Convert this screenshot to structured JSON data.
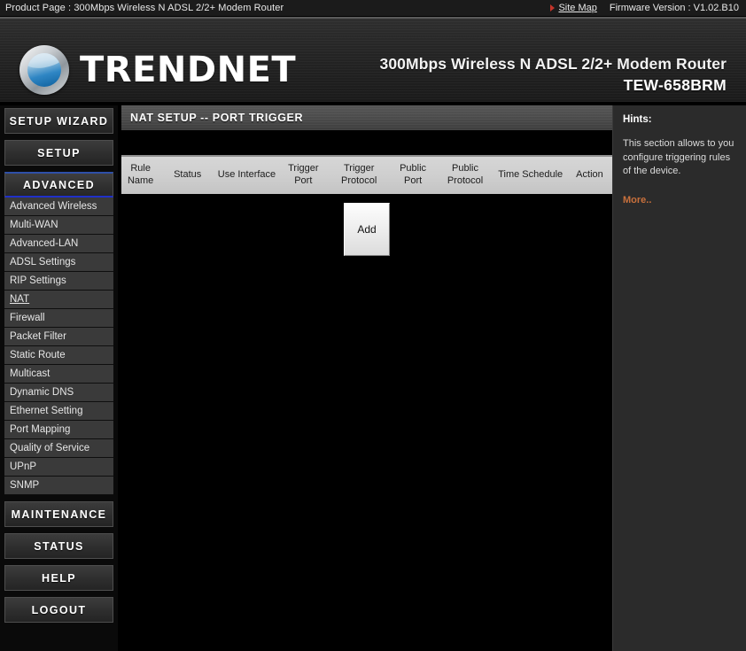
{
  "topbar": {
    "product_label": "Product Page : 300Mbps Wireless N ADSL 2/2+ Modem Router",
    "site_map_link": "Site Map",
    "firmware_label": "Firmware Version :  V1.02.B10",
    "arrow_color": "#c4342a"
  },
  "header": {
    "brand": "TRENDNET",
    "model_line1": "300Mbps Wireless N ADSL 2/2+ Modem Router",
    "model_line2": "TEW-658BRM"
  },
  "sidebar": {
    "main_items": [
      {
        "label": "SETUP WIZARD",
        "active": false
      },
      {
        "label": "SETUP",
        "active": false
      },
      {
        "label": "ADVANCED",
        "active": true
      }
    ],
    "sub_items": [
      {
        "label": "Advanced Wireless",
        "current": false
      },
      {
        "label": "Multi-WAN",
        "current": false
      },
      {
        "label": "Advanced-LAN",
        "current": false
      },
      {
        "label": "ADSL Settings",
        "current": false
      },
      {
        "label": "RIP Settings",
        "current": false
      },
      {
        "label": "NAT",
        "current": true
      },
      {
        "label": "Firewall",
        "current": false
      },
      {
        "label": "Packet Filter",
        "current": false
      },
      {
        "label": "Static Route",
        "current": false
      },
      {
        "label": "Multicast",
        "current": false
      },
      {
        "label": "Dynamic DNS",
        "current": false
      },
      {
        "label": "Ethernet Setting",
        "current": false
      },
      {
        "label": "Port Mapping",
        "current": false
      },
      {
        "label": "Quality of Service",
        "current": false
      },
      {
        "label": "UPnP",
        "current": false
      },
      {
        "label": "SNMP",
        "current": false
      }
    ],
    "bottom_items": [
      {
        "label": "MAINTENANCE"
      },
      {
        "label": "STATUS"
      },
      {
        "label": "HELP"
      },
      {
        "label": "LOGOUT"
      }
    ]
  },
  "main": {
    "panel_title": "NAT SETUP -- PORT TRIGGER",
    "table": {
      "columns": [
        "Rule Name",
        "Status",
        "Use Interface",
        "Trigger Port",
        "Trigger Protocol",
        "Public Port",
        "Public Protocol",
        "Time Schedule",
        "Action"
      ],
      "rows": []
    },
    "add_button": "Add"
  },
  "hints": {
    "title": "Hints:",
    "body": "This section allows to you configure triggering rules of the device.",
    "more_link": "More..",
    "more_color": "#c8703c"
  }
}
